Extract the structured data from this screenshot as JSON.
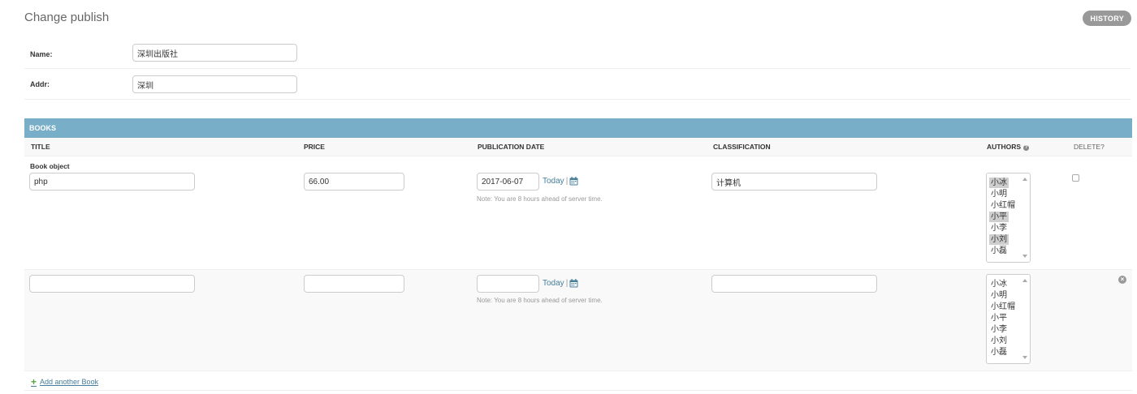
{
  "page": {
    "title": "Change publish",
    "history_label": "HISTORY"
  },
  "fields": {
    "name": {
      "label": "Name:",
      "value": "深圳出版社"
    },
    "addr": {
      "label": "Addr:",
      "value": "深圳"
    }
  },
  "inline": {
    "section_title": "BOOKS",
    "columns": {
      "title": "TITLE",
      "price": "PRICE",
      "publication_date": "PUBLICATION DATE",
      "classification": "CLASSIFICATION",
      "authors": "AUTHORS",
      "delete": "DELETE?"
    },
    "today_label": "Today",
    "today_sep": "|",
    "server_note": "Note: You are 8 hours ahead of server time.",
    "add_another_label": "Add another Book",
    "authors_options": [
      "小冰",
      "小明",
      "小红帽",
      "小平",
      "小李",
      "小刘",
      "小磊"
    ],
    "rows": [
      {
        "object_label": "Book object",
        "title": "php",
        "price": "66.00",
        "publication_date": "2017-06-07",
        "classification": "计算机",
        "selected_authors": [
          "小冰",
          "小平",
          "小刘"
        ]
      },
      {
        "object_label": "",
        "title": "",
        "price": "",
        "publication_date": "",
        "classification": "",
        "selected_authors": []
      }
    ]
  },
  "icons": {
    "calendar": "calendar-icon",
    "help": "help-icon",
    "remove": "remove-icon",
    "add": "plus-icon"
  },
  "colors": {
    "section_header_bg": "#79aec8",
    "link": "#447e9b",
    "add_icon": "#5aa345",
    "history_bg": "#999999"
  }
}
